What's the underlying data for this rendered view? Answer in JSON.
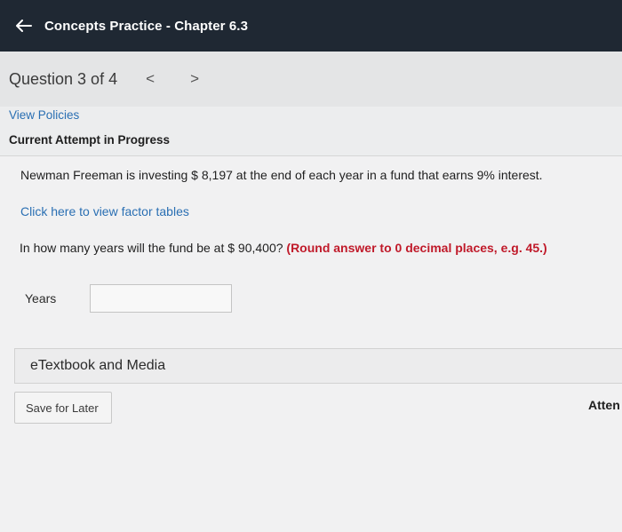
{
  "header": {
    "back_icon": "arrow-left-icon",
    "title": "Concepts Practice - Chapter 6.3"
  },
  "question_nav": {
    "label": "Question 3 of 4",
    "prev": "<",
    "next": ">"
  },
  "policies_link": "View Policies",
  "attempt_status": "Current Attempt in Progress",
  "question": {
    "text": "Newman Freeman is investing $ 8,197 at the end of each year in a fund that earns 9% interest.",
    "factor_link": "Click here to view factor tables",
    "prompt": "In how many years will the fund be at $ 90,400? ",
    "instruction": "(Round answer to 0 decimal places, e.g. 45.)",
    "answer_label": "Years",
    "answer_value": ""
  },
  "etextbook_label": "eTextbook and Media",
  "save_later_label": "Save for Later",
  "attempts_label": "Atten",
  "colors": {
    "header_bg": "#1f2833",
    "link": "#2a6fb3",
    "emphasis": "#c01a2a"
  }
}
